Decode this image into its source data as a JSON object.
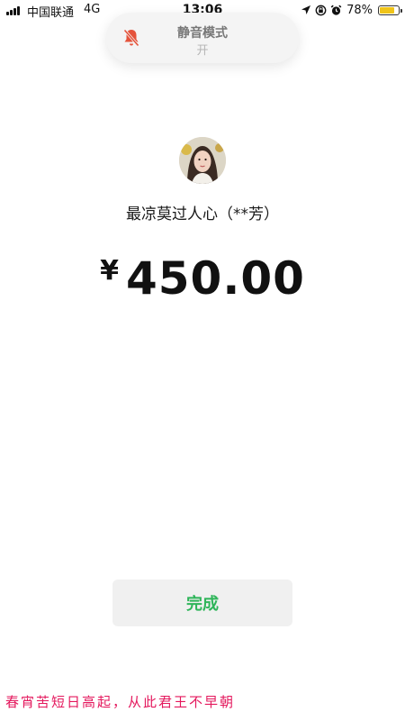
{
  "status_bar": {
    "carrier": "中国联通",
    "network": "4G",
    "time": "13:06",
    "battery_percent": "78%",
    "battery_level": 0.78,
    "icons": [
      "signal-bars-icon",
      "location-arrow-icon",
      "orientation-lock-icon",
      "alarm-icon",
      "battery-icon"
    ]
  },
  "silent_mode": {
    "title": "静音模式",
    "state": "开",
    "icon": "bell-slash-icon",
    "icon_color": "#e5533b"
  },
  "payment": {
    "avatar": "payee-avatar",
    "payee": "最凉莫过人心（**芳）",
    "currency": "¥",
    "amount": "450.00"
  },
  "actions": {
    "done_label": "完成",
    "accent_color": "#2fb55a"
  },
  "footer": {
    "poem": "春宵苦短日高起，从此君王不早朝",
    "color": "#e4185d"
  }
}
